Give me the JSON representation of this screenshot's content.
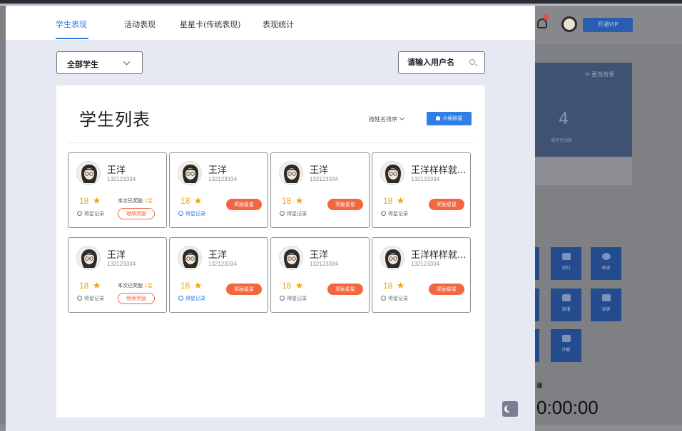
{
  "tabs": [
    "学生表现",
    "活动表现",
    "星星卡(传统表现)",
    "表现统计"
  ],
  "active_tab": 0,
  "filter": {
    "label": "全部学生"
  },
  "search": {
    "placeholder": "请输入用户名"
  },
  "panel": {
    "title": "学生列表",
    "sort_label": "按姓名排序",
    "group_button": "小组给星"
  },
  "labels": {
    "awarded_prefix": "本次已奖励",
    "awarded_count": "1星",
    "continue_reward": "继续奖励",
    "reward_stars": "奖励星星",
    "star_record": "得星记录"
  },
  "students": [
    {
      "name": "王洋",
      "id": "132123334",
      "stars": "18",
      "state": "awarded",
      "record_active": false
    },
    {
      "name": "王洋",
      "id": "132123334",
      "stars": "18",
      "state": "reward",
      "record_active": true
    },
    {
      "name": "王洋",
      "id": "132123334",
      "stars": "18",
      "state": "reward",
      "record_active": false
    },
    {
      "name": "王洋样样就...",
      "id": "132123334",
      "stars": "18",
      "state": "reward",
      "record_active": false
    },
    {
      "name": "王洋",
      "id": "132123334",
      "stars": "18",
      "state": "awarded",
      "record_active": false
    },
    {
      "name": "王洋",
      "id": "132123334",
      "stars": "18",
      "state": "reward",
      "record_active": true
    },
    {
      "name": "王洋",
      "id": "132123334",
      "stars": "18",
      "state": "reward",
      "record_active": false
    },
    {
      "name": "王洋样样就...",
      "id": "132123334",
      "stars": "18",
      "state": "reward",
      "record_active": false
    }
  ],
  "background": {
    "vip_button": "开通VIP",
    "change_bg": "更改背景",
    "stat_value": "4",
    "stat_label": "课堂互动数",
    "tiles": [
      "资料",
      "表现",
      "直播",
      "录屏",
      "评教"
    ],
    "timer_label": "课",
    "timer": "0:00:00"
  },
  "colors": {
    "accent": "#2f7fe6",
    "reward": "#f2673f",
    "star": "#f3a316"
  }
}
